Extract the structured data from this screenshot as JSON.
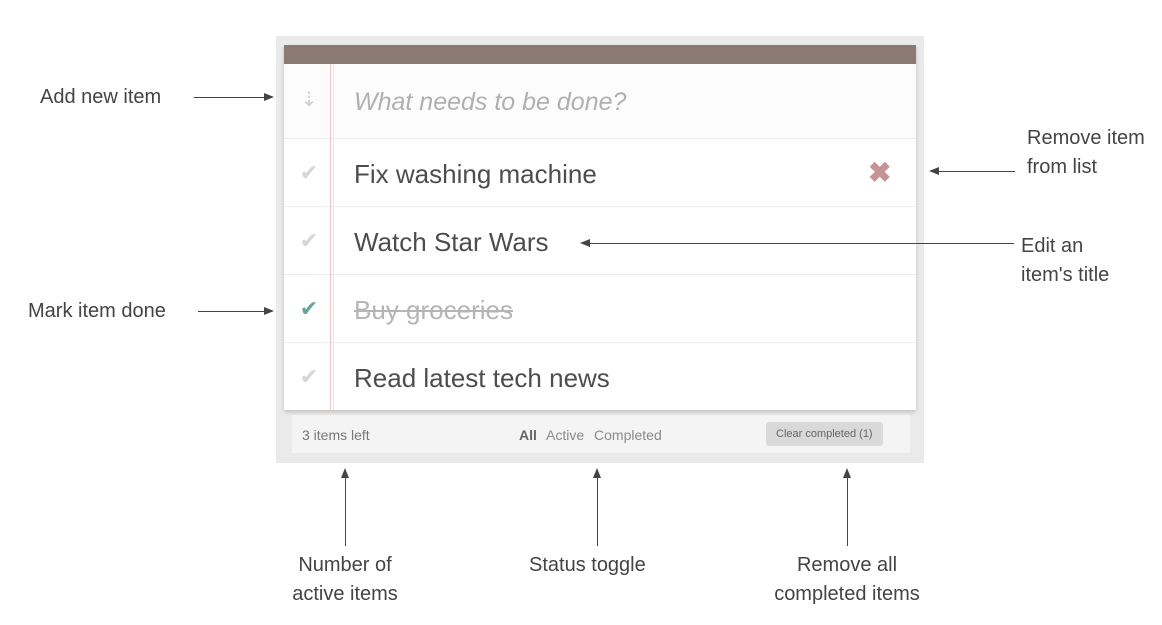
{
  "app": {
    "new_todo_placeholder": "What needs to be done?",
    "items": [
      {
        "title": "Fix washing machine",
        "completed": false
      },
      {
        "title": "Watch Star Wars",
        "completed": false
      },
      {
        "title": "Buy groceries",
        "completed": true
      },
      {
        "title": "Read latest tech news",
        "completed": false
      }
    ],
    "footer": {
      "count_text": "3 items left",
      "filters": [
        "All",
        "Active",
        "Completed"
      ],
      "selected_filter": "All",
      "clear_label": "Clear completed (1)"
    }
  },
  "annotations": {
    "add_new_item": "Add  new item",
    "mark_item_done": "Mark item done",
    "remove_item": [
      "Remove item",
      "from list"
    ],
    "edit_title": [
      "Edit an",
      "item's title"
    ],
    "number_active": [
      "Number of",
      "active items"
    ],
    "status_toggle": "Status toggle",
    "remove_all": [
      "Remove all",
      "completed items"
    ]
  },
  "colors": {
    "header_bar": "#8b7a71",
    "check_done": "#6aa39b",
    "destroy": "#c59494",
    "margin_line": "#f3c6c6"
  },
  "icons": {
    "toggle_all": "chevron-double-down-icon",
    "check": "checkmark-icon",
    "destroy": "cross-icon"
  }
}
